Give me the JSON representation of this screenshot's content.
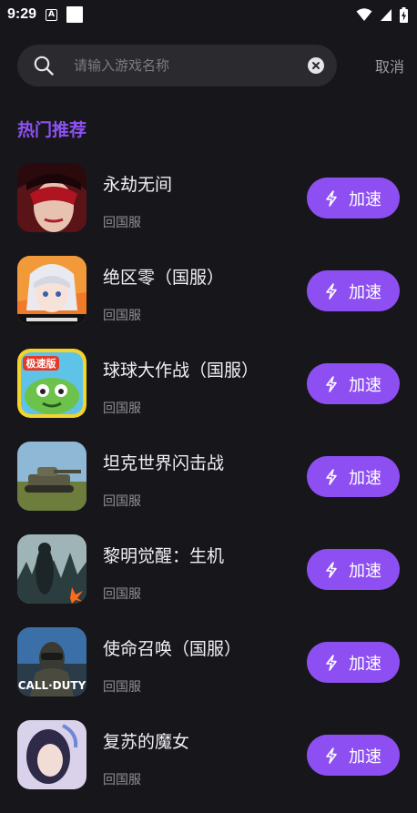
{
  "status_bar": {
    "time": "9:29",
    "notif_glyph": "A",
    "icons": [
      "notification-a-icon",
      "notification-square-icon",
      "wifi-icon",
      "signal-icon",
      "battery-charging-icon"
    ]
  },
  "search": {
    "placeholder": "请输入游戏名称",
    "value": "",
    "cancel_label": "取消"
  },
  "section": {
    "title": "热门推荐"
  },
  "games": [
    {
      "name": "永劫无间",
      "tag": "回国服",
      "button": "加速"
    },
    {
      "name": "绝区零（国服）",
      "tag": "回国服",
      "button": "加速"
    },
    {
      "name": "球球大作战（国服）",
      "tag": "回国服",
      "button": "加速",
      "icon_text": "极速版"
    },
    {
      "name": "坦克世界闪击战",
      "tag": "回国服",
      "button": "加速"
    },
    {
      "name": "黎明觉醒：生机",
      "tag": "回国服",
      "button": "加速"
    },
    {
      "name": "使命召唤（国服）",
      "tag": "回国服",
      "button": "加速",
      "icon_text": "CALL·DUTY"
    },
    {
      "name": "复苏的魔女",
      "tag": "回国服",
      "button": "加速"
    }
  ],
  "colors": {
    "background": "#17171b",
    "accent": "#8e4ff2",
    "section_title": "#8d52f2",
    "search_bg": "#2a2a2f"
  }
}
